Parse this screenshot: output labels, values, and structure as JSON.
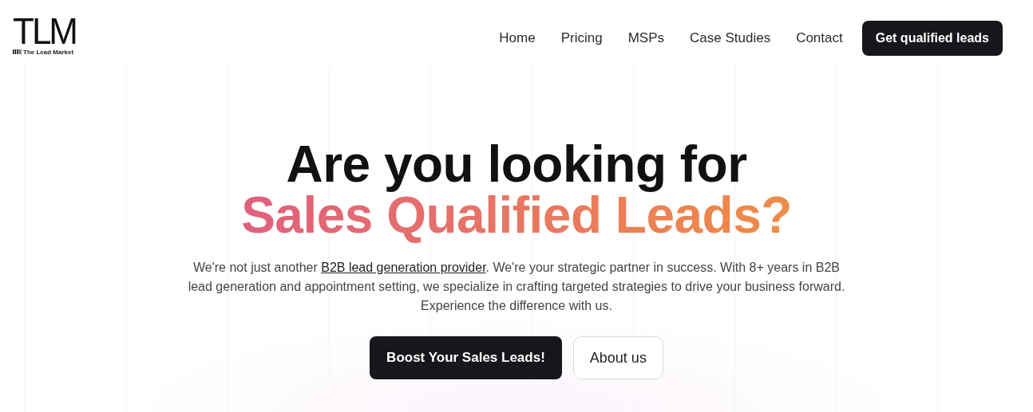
{
  "logo": {
    "mark": "TLM",
    "name": "The Lead Market"
  },
  "nav": {
    "links": [
      "Home",
      "Pricing",
      "MSPs",
      "Case Studies",
      "Contact"
    ],
    "cta": "Get qualified leads"
  },
  "hero": {
    "title_line1": "Are you looking for",
    "title_line2": "Sales Qualified Leads?",
    "intro_before": "We're not just another ",
    "intro_link": "B2B lead generation provider",
    "intro_after": ". We're your strategic partner in success. With 8+ years in B2B lead generation and appointment setting, we specialize in crafting targeted strategies to drive your business forward. Experience the difference with us.",
    "primary_button": "Boost Your Sales Leads!",
    "secondary_button": "About us"
  }
}
